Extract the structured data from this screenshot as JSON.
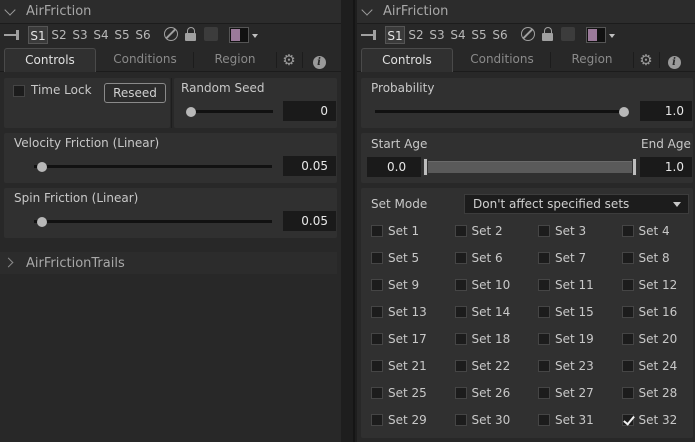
{
  "colors": {
    "panel_bg": "#282828",
    "group_bg": "#303030",
    "value_bg": "#1a1a1a",
    "swatch_color": "#9b7a9a"
  },
  "toolbar": {
    "pin_icon": "pin-icon",
    "sets": [
      "S1",
      "S2",
      "S3",
      "S4",
      "S5",
      "S6"
    ],
    "active_set": "S1",
    "icons": [
      "no-entry-icon",
      "lock-icon",
      "disk-icon"
    ]
  },
  "tabs": {
    "controls": "Controls",
    "conditions": "Conditions",
    "region": "Region",
    "settings_icon": "gear-icon",
    "info_icon": "info-icon",
    "info_glyph": "i",
    "gear_glyph": "⚙"
  },
  "left": {
    "title": "AirFriction",
    "time_lock": {
      "label": "Time Lock",
      "checked": false
    },
    "reseed_label": "Reseed",
    "random_seed": {
      "label": "Random Seed",
      "value": "0"
    },
    "velocity_friction": {
      "label": "Velocity Friction (Linear)",
      "value": "0.05",
      "level": 0.05
    },
    "spin_friction": {
      "label": "Spin Friction (Linear)",
      "value": "0.05",
      "level": 0.05
    },
    "collapsed_title": "AirFrictionTrails"
  },
  "right": {
    "title": "AirFriction",
    "probability": {
      "label": "Probability",
      "value": "1.0",
      "level": 1.0
    },
    "start_age": {
      "label": "Start Age",
      "value": "0.0"
    },
    "end_age": {
      "label": "End Age",
      "value": "1.0"
    },
    "set_mode": {
      "label": "Set Mode",
      "value": "Don't affect specified sets"
    },
    "sets": [
      {
        "label": "Set  1",
        "checked": false
      },
      {
        "label": "Set  2",
        "checked": false
      },
      {
        "label": "Set  3",
        "checked": false
      },
      {
        "label": "Set  4",
        "checked": false
      },
      {
        "label": "Set  5",
        "checked": false
      },
      {
        "label": "Set  6",
        "checked": false
      },
      {
        "label": "Set  7",
        "checked": false
      },
      {
        "label": "Set  8",
        "checked": false
      },
      {
        "label": "Set  9",
        "checked": false
      },
      {
        "label": "Set 10",
        "checked": false
      },
      {
        "label": "Set 11",
        "checked": false
      },
      {
        "label": "Set 12",
        "checked": false
      },
      {
        "label": "Set 13",
        "checked": false
      },
      {
        "label": "Set 14",
        "checked": false
      },
      {
        "label": "Set 15",
        "checked": false
      },
      {
        "label": "Set 16",
        "checked": false
      },
      {
        "label": "Set 17",
        "checked": false
      },
      {
        "label": "Set 18",
        "checked": false
      },
      {
        "label": "Set 19",
        "checked": false
      },
      {
        "label": "Set 20",
        "checked": false
      },
      {
        "label": "Set 21",
        "checked": false
      },
      {
        "label": "Set 22",
        "checked": false
      },
      {
        "label": "Set 23",
        "checked": false
      },
      {
        "label": "Set 24",
        "checked": false
      },
      {
        "label": "Set 25",
        "checked": false
      },
      {
        "label": "Set 26",
        "checked": false
      },
      {
        "label": "Set 27",
        "checked": false
      },
      {
        "label": "Set 28",
        "checked": false
      },
      {
        "label": "Set 29",
        "checked": false
      },
      {
        "label": "Set 30",
        "checked": false
      },
      {
        "label": "Set 31",
        "checked": false
      },
      {
        "label": "Set 32",
        "checked": true
      }
    ]
  }
}
